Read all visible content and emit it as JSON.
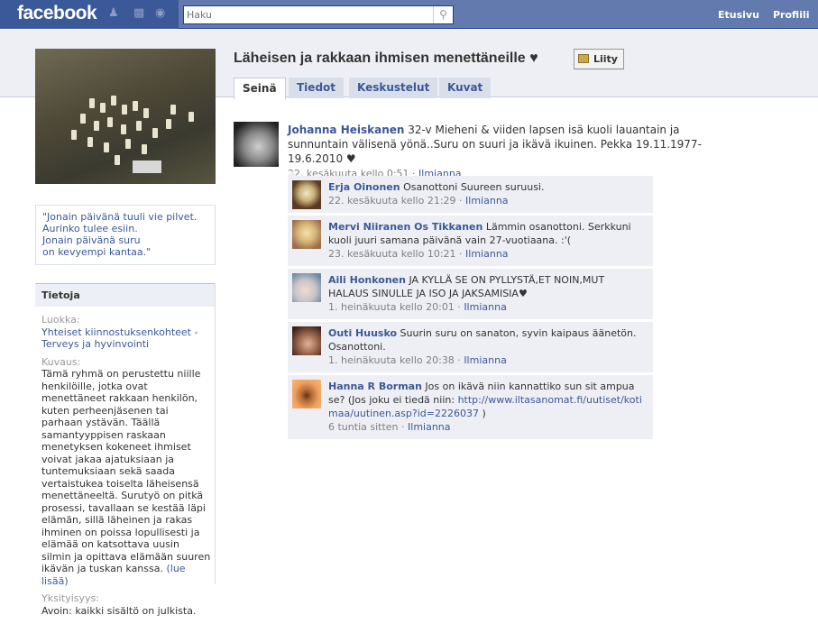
{
  "topbar": {
    "logo": "facebook",
    "search_placeholder": "Haku",
    "nav": [
      "Etusivu",
      "Profiili"
    ]
  },
  "group": {
    "title": "Läheisen ja rakkaan ihmisen menettäneille ♥",
    "join_label": "Liity",
    "tabs": [
      {
        "label": "Seinä",
        "active": true
      },
      {
        "label": "Tiedot"
      },
      {
        "label": "Keskustelut"
      },
      {
        "label": "Kuvat"
      }
    ]
  },
  "quote": [
    "\"Jonain päivänä tuuli vie pilvet.",
    "Aurinko tulee esiin.",
    "Jonain päivänä suru",
    "on kevyempi kantaa.\""
  ],
  "info": {
    "header": "Tietoja",
    "category_label": "Luokka:",
    "category_link1": "Yhteiset kiinnostuksenkohteet",
    "category_sep": " -",
    "category_link2": "Terveys ja hyvinvointi",
    "description_label": "Kuvaus:",
    "description": "Tämä ryhmä on perustettu niille henkilöille, jotka ovat menettäneet rakkaan henkilön, kuten perheenjäsenen tai parhaan ystävän. Täällä samantyyppisen raskaan menetyksen kokeneet ihmiset voivat jakaa ajatuksiaan ja tuntemuksiaan sekä saada vertaistukea toiselta läheisensä menettäneeltä. Surutyö on pitkä prosessi, tavallaan se kestää läpi elämän, sillä läheinen ja rakas ihminen on poissa lopullisesti ja elämää on katsottava uusin silmin ja opittava elämään suuren ikävän ja tuskan kanssa. ",
    "read_more": "(lue lisää)",
    "privacy_label": "Yksityisyys:",
    "privacy": "Avoin: kaikki sisältö on julkista."
  },
  "post": {
    "author": "Johanna Heiskanen",
    "text": " 32-v Mieheni & viiden lapsen isä kuoli lauantain ja sunnuntain välisenä yönä..Suru on suuri ja ikävä ikuinen. Pekka 19.11.1977- 19.6.2010 ♥",
    "time": "22. kesäkuuta kello 0:51",
    "report": "Ilmianna"
  },
  "comments": [
    {
      "author": "Erja Oinonen",
      "text": " Osanottoni Suureen suruusi.",
      "time": "22. kesäkuuta kello 21:29",
      "report": "Ilmianna"
    },
    {
      "author": "Mervi Niiranen Os Tikkanen",
      "text": " Lämmin osanottoni. Serkkuni kuoli juuri samana päivänä vain 27-vuotiaana. :'(",
      "time": "23. kesäkuuta kello 10:21",
      "report": "Ilmianna"
    },
    {
      "author": "Aili Honkonen",
      "text": " JA KYLLÄ SE ON PYLLYSTÄ,ET NOIN,MUT HALAUS SINULLE JA ISO JA JAKSAMISIA♥",
      "time": "1. heinäkuuta kello 20:01",
      "report": "Ilmianna"
    },
    {
      "author": "Outi Huusko",
      "text": " Suurin suru on sanaton, syvin kaipaus äänetön. Osanottoni.",
      "time": "1. heinäkuuta kello 20:38",
      "report": "Ilmianna"
    },
    {
      "author": "Hanna R Borman",
      "text": " Jos on ikävä niin kannattiko sun sit ampua se? (Jos joku ei tiedä niin: ",
      "link": "http://www.iltasanomat.fi/uutiset/kotimaa/uutinen.asp?id=2226037",
      "text_after": " )",
      "time": "6 tuntia sitten",
      "report": "Ilmianna"
    }
  ]
}
